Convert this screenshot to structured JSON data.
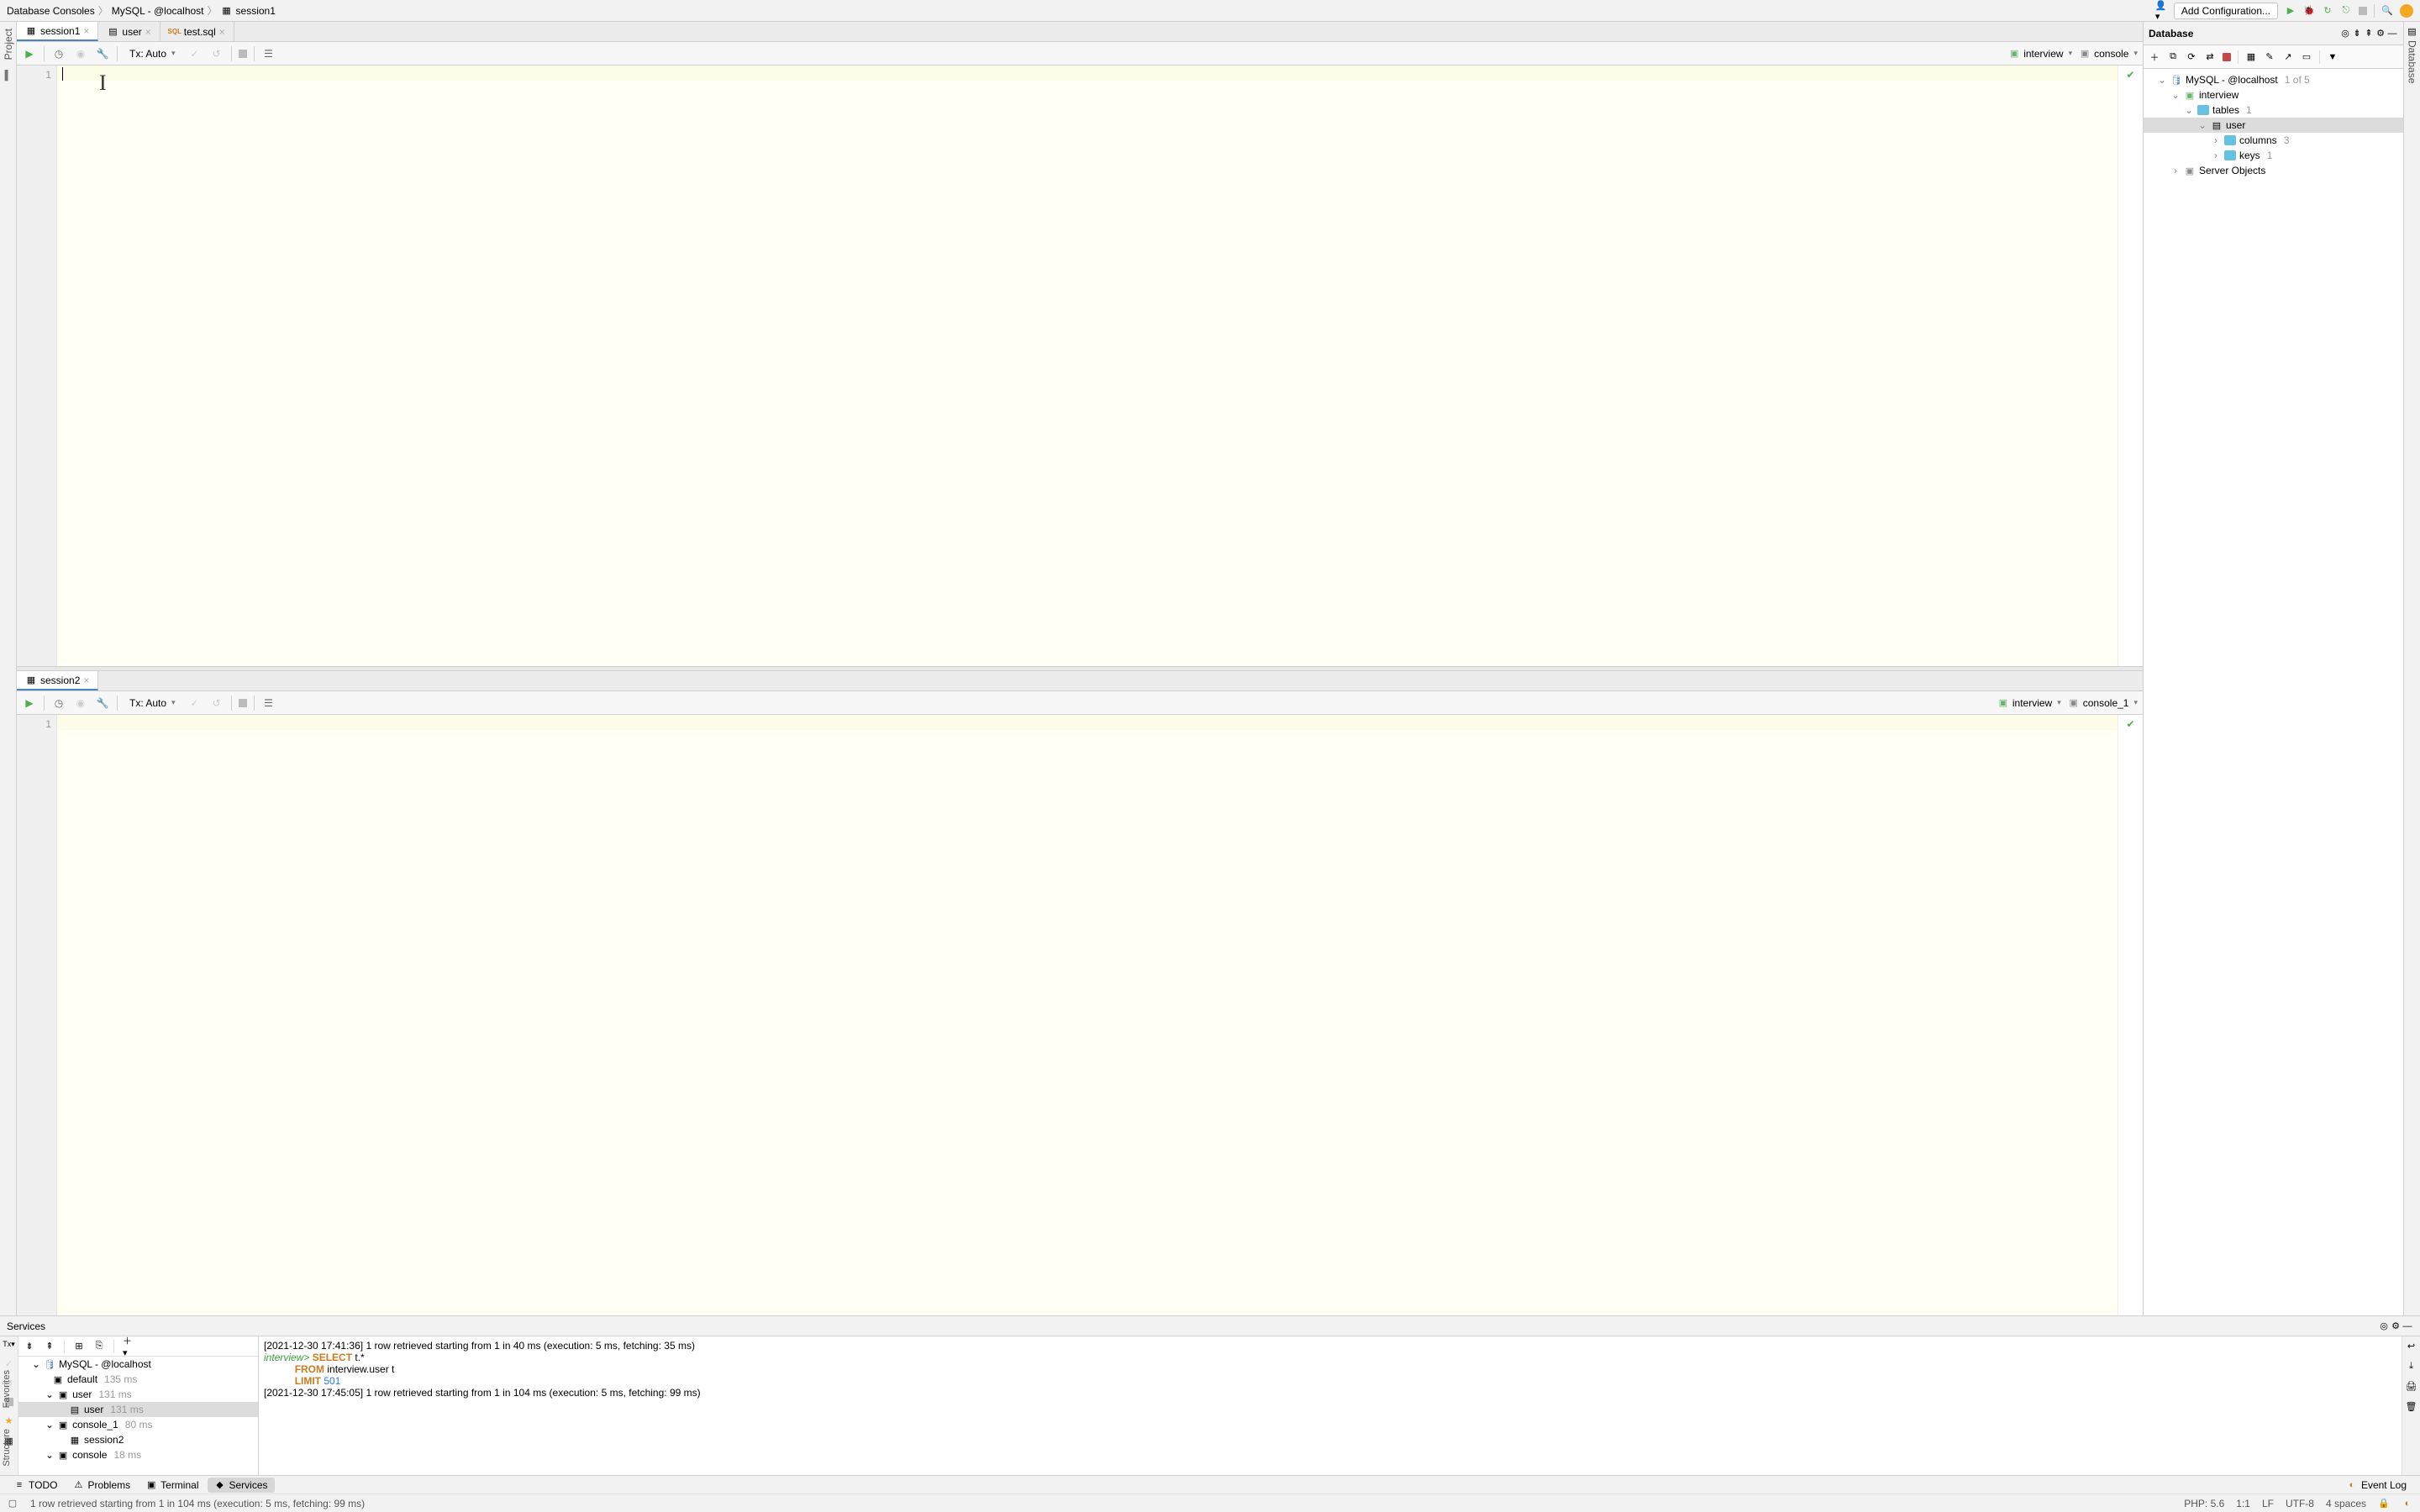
{
  "breadcrumb": [
    "Database Consoles",
    "MySQL - @localhost",
    "session1"
  ],
  "nav_right": {
    "add_config": "Add Configuration..."
  },
  "editor_tabs": [
    {
      "label": "session1",
      "active": true,
      "icon": "console"
    },
    {
      "label": "user",
      "active": false,
      "icon": "table"
    },
    {
      "label": "test.sql",
      "active": false,
      "icon": "sql"
    }
  ],
  "editor1": {
    "tx_label": "Tx: Auto",
    "schema": "interview",
    "session": "console",
    "line": "1"
  },
  "editor_tabs2": [
    {
      "label": "session2",
      "active": true
    }
  ],
  "editor2": {
    "tx_label": "Tx: Auto",
    "schema": "interview",
    "session": "console_1",
    "line": "1"
  },
  "db_panel": {
    "title": "Database",
    "root": {
      "label": "MySQL - @localhost",
      "count": "1 of 5"
    },
    "interview": "interview",
    "tables": {
      "label": "tables",
      "count": "1"
    },
    "user": "user",
    "columns": {
      "label": "columns",
      "count": "3"
    },
    "keys": {
      "label": "keys",
      "count": "1"
    },
    "server_objects": "Server Objects"
  },
  "services": {
    "title": "Services",
    "tree": {
      "root": "MySQL - @localhost",
      "default": {
        "label": "default",
        "timing": "135 ms"
      },
      "user_group": {
        "label": "user",
        "timing": "131 ms"
      },
      "user_row": {
        "label": "user",
        "timing": "131 ms"
      },
      "console1": {
        "label": "console_1",
        "timing": "80 ms"
      },
      "session2": "session2",
      "console": {
        "label": "console",
        "timing": "18 ms"
      }
    },
    "log": {
      "l1_ts": "[2021-12-30 17:41:36]",
      "l1_msg": "1 row retrieved starting from 1 in 40 ms (execution: 5 ms, fetching: 35 ms)",
      "prompt": "interview>",
      "q_select": "SELECT",
      "q_sel_rest": " t.*",
      "q_from": "FROM",
      "q_from_rest": " interview.user t",
      "q_limit": "LIMIT",
      "q_limit_val": "501",
      "l2_ts": "[2021-12-30 17:45:05]",
      "l2_msg": "1 row retrieved starting from 1 in 104 ms (execution: 5 ms, fetching: 99 ms)"
    }
  },
  "bottom_tabs": {
    "todo": "TODO",
    "problems": "Problems",
    "terminal": "Terminal",
    "services": "Services",
    "event_log": "Event Log"
  },
  "status": {
    "msg": "1 row retrieved starting from 1 in 104 ms (execution: 5 ms, fetching: 99 ms)",
    "php": "PHP: 5.6",
    "pos": "1:1",
    "lf": "LF",
    "enc": "UTF-8",
    "indent": "4 spaces"
  },
  "rails": {
    "project": "Project",
    "database": "Database",
    "structure": "Structure",
    "favorites": "Favorites"
  }
}
